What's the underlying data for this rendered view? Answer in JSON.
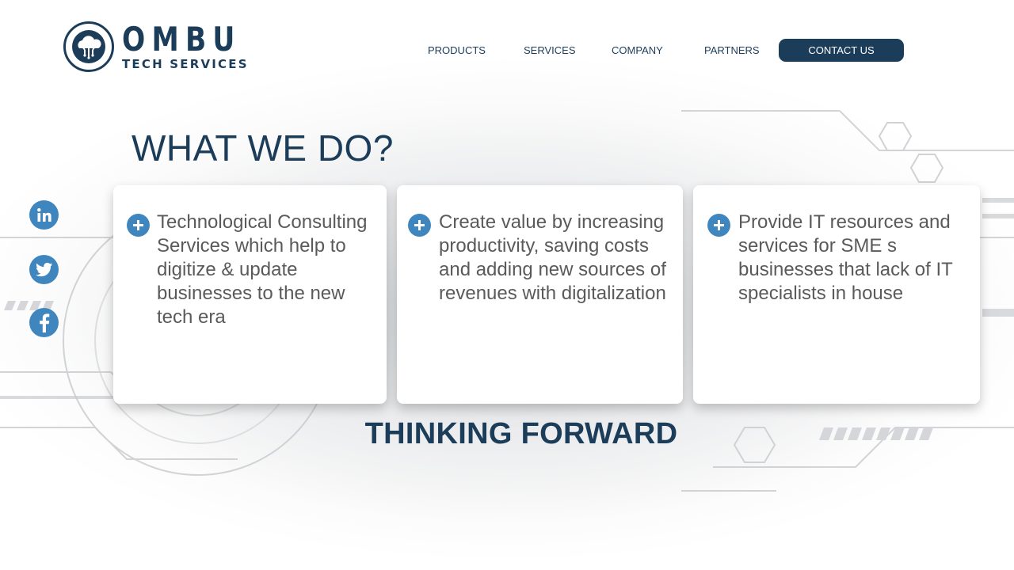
{
  "brand": {
    "name": "OMBU",
    "subtitle": "TECH SERVICES",
    "logo_icon": "cloud-circuit-icon"
  },
  "nav": {
    "items": [
      {
        "label": "PRODUCTS"
      },
      {
        "label": "SERVICES"
      },
      {
        "label": "COMPANY"
      },
      {
        "label": "PARTNERS"
      }
    ],
    "contact_label": "CONTACT US"
  },
  "main": {
    "title": "WHAT WE DO?",
    "cards": [
      {
        "text": "Technological Consulting Services which help to digitize & update businesses to the new tech era",
        "icon": "plus-icon"
      },
      {
        "text": "Create value by increasing productivity, saving costs and adding new sources of revenues with digitalization",
        "icon": "plus-icon"
      },
      {
        "text": "Provide IT resources and services for SME s businesses that lack of IT specialists in house",
        "icon": "plus-icon"
      }
    ],
    "tagline": "THINKING FORWARD"
  },
  "social": [
    {
      "icon": "linkedin-icon"
    },
    {
      "icon": "twitter-icon"
    },
    {
      "icon": "facebook-icon"
    }
  ],
  "colors": {
    "primary": "#1c3d5a",
    "accent": "#3f86bf",
    "card_text": "#5a5a5a"
  }
}
